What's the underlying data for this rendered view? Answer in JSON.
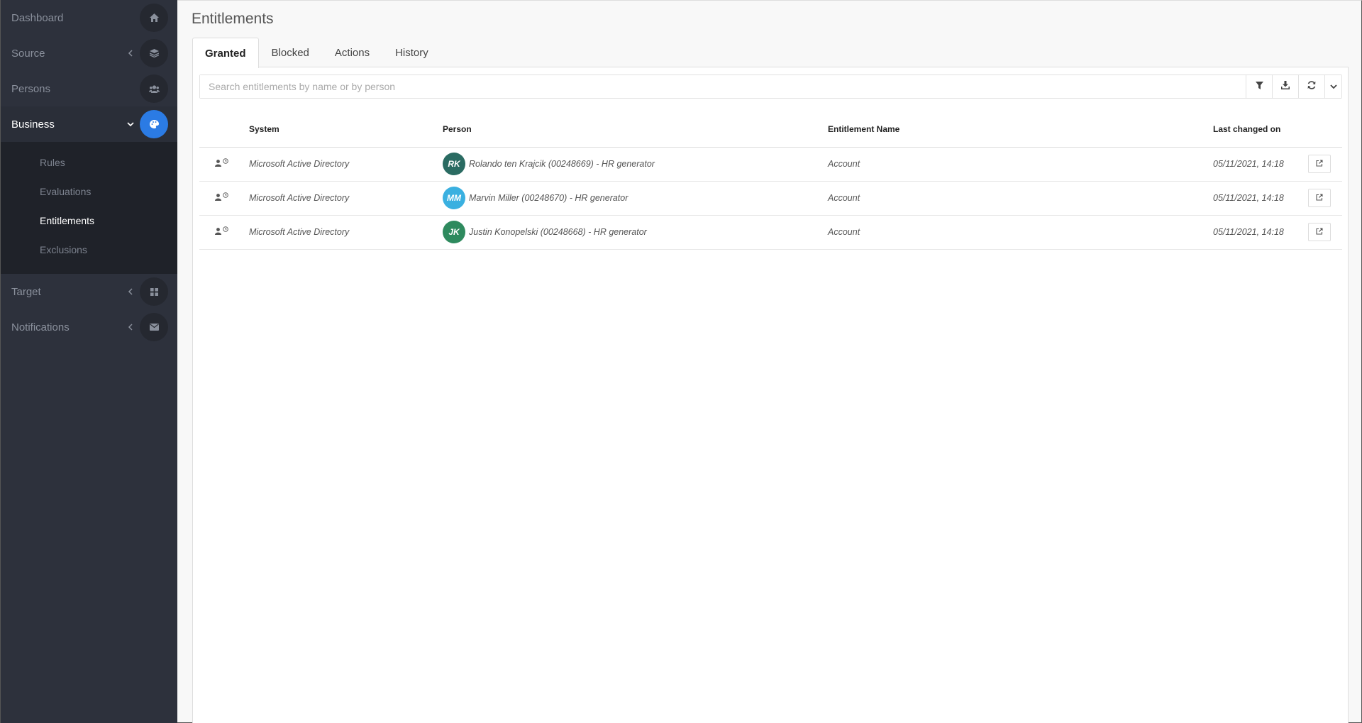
{
  "sidebar": {
    "items": [
      {
        "label": "Dashboard",
        "icon": "home-icon"
      },
      {
        "label": "Source",
        "icon": "layers-icon"
      },
      {
        "label": "Persons",
        "icon": "users-icon"
      },
      {
        "label": "Business",
        "icon": "palette-icon"
      },
      {
        "label": "Target",
        "icon": "grid-icon"
      },
      {
        "label": "Notifications",
        "icon": "envelope-icon"
      }
    ],
    "business_sub": [
      "Rules",
      "Evaluations",
      "Entitlements",
      "Exclusions"
    ]
  },
  "page": {
    "title": "Entitlements"
  },
  "tabs": [
    "Granted",
    "Blocked",
    "Actions",
    "History"
  ],
  "search": {
    "placeholder": "Search entitlements by name or by person"
  },
  "table": {
    "headers": [
      "System",
      "Person",
      "Entitlement Name",
      "Last changed on"
    ],
    "rows": [
      {
        "system": "Microsoft Active Directory",
        "initials": "RK",
        "avatar_color": "#2a6b62",
        "person": "Rolando ten Krajcik (00248669) - HR generator",
        "entitlement": "Account",
        "changed": "05/11/2021, 14:18"
      },
      {
        "system": "Microsoft Active Directory",
        "initials": "MM",
        "avatar_color": "#3ab0e0",
        "person": "Marvin Miller (00248670) - HR generator",
        "entitlement": "Account",
        "changed": "05/11/2021, 14:18"
      },
      {
        "system": "Microsoft Active Directory",
        "initials": "JK",
        "avatar_color": "#2e8a5e",
        "person": "Justin Konopelski (00248668) - HR generator",
        "entitlement": "Account",
        "changed": "05/11/2021, 14:18"
      }
    ]
  },
  "colors": {
    "accent": "#2b7be4",
    "sidebar_bg": "#2d313c"
  }
}
